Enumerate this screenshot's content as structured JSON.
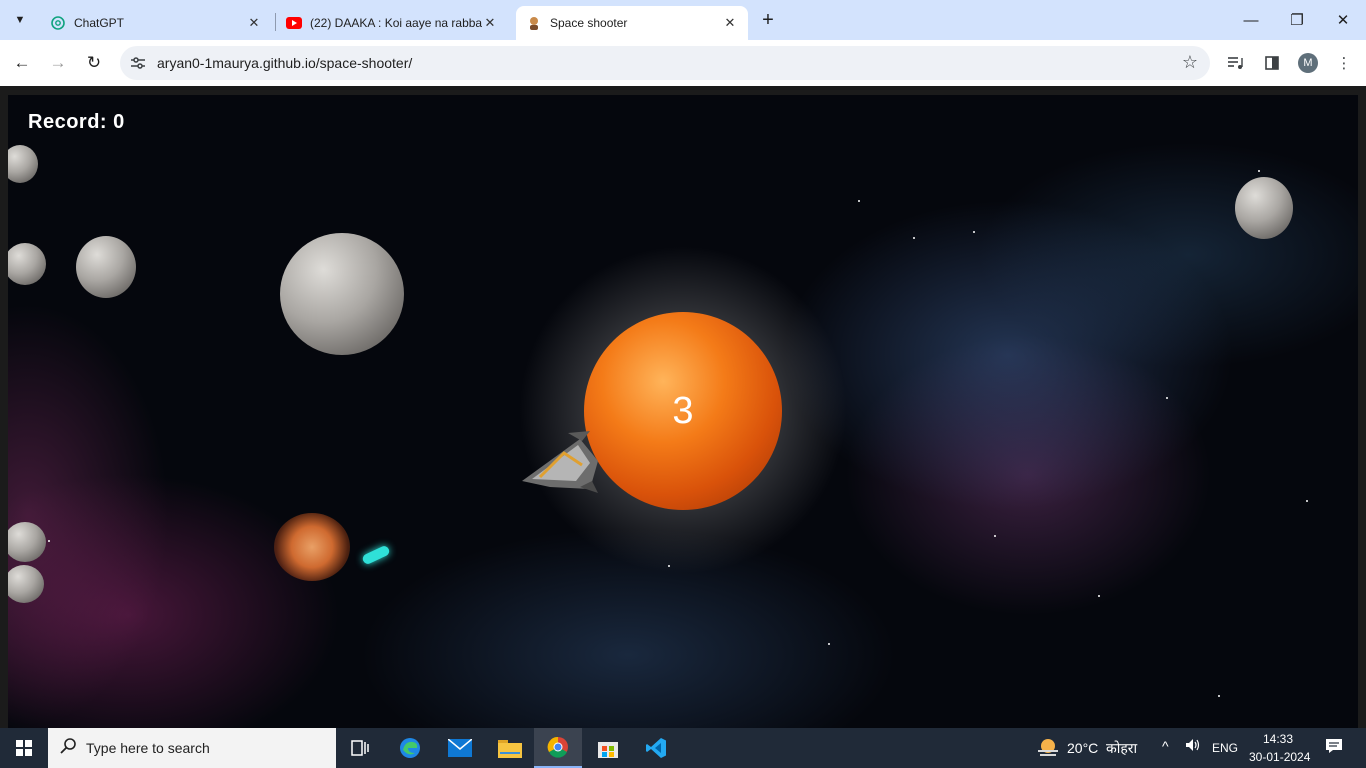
{
  "browser": {
    "tab_search_icon": "chevron-down-icon",
    "tabs": [
      {
        "title": "ChatGPT",
        "favicon": "chatgpt-logo-icon",
        "active": false
      },
      {
        "title": "(22) DAAKA : Koi aaye na rabba",
        "favicon": "youtube-logo-icon",
        "active": false
      },
      {
        "title": "Space shooter",
        "favicon": "site-favicon-icon",
        "active": true
      }
    ],
    "new_tab_label": "+",
    "window_controls": {
      "minimize": "—",
      "restore": "❐",
      "close": "✕"
    },
    "toolbar": {
      "back": "←",
      "forward": "→",
      "reload": "↻",
      "url": "aryan0-1maurya.github.io/space-shooter/",
      "bookmark": "☆",
      "profile_initial": "M"
    }
  },
  "game": {
    "record_label": "Record: 0",
    "countdown": "3"
  },
  "taskbar": {
    "start_icon": "windows-logo-icon",
    "search_placeholder": "Type here to search",
    "pinned_apps": [
      "task-view",
      "edge",
      "mail",
      "file-explorer",
      "chrome",
      "microsoft-store",
      "vs-code"
    ],
    "weather": {
      "temperature": "20°C",
      "condition": "कोहरा"
    },
    "language": "ENG",
    "time": "14:33",
    "date": "30-01-2024"
  },
  "colors": {
    "tabstrip": "#d3e3fd",
    "taskbar": "#202a38",
    "planet": "#f47b18",
    "laser": "#2fe0d8"
  }
}
